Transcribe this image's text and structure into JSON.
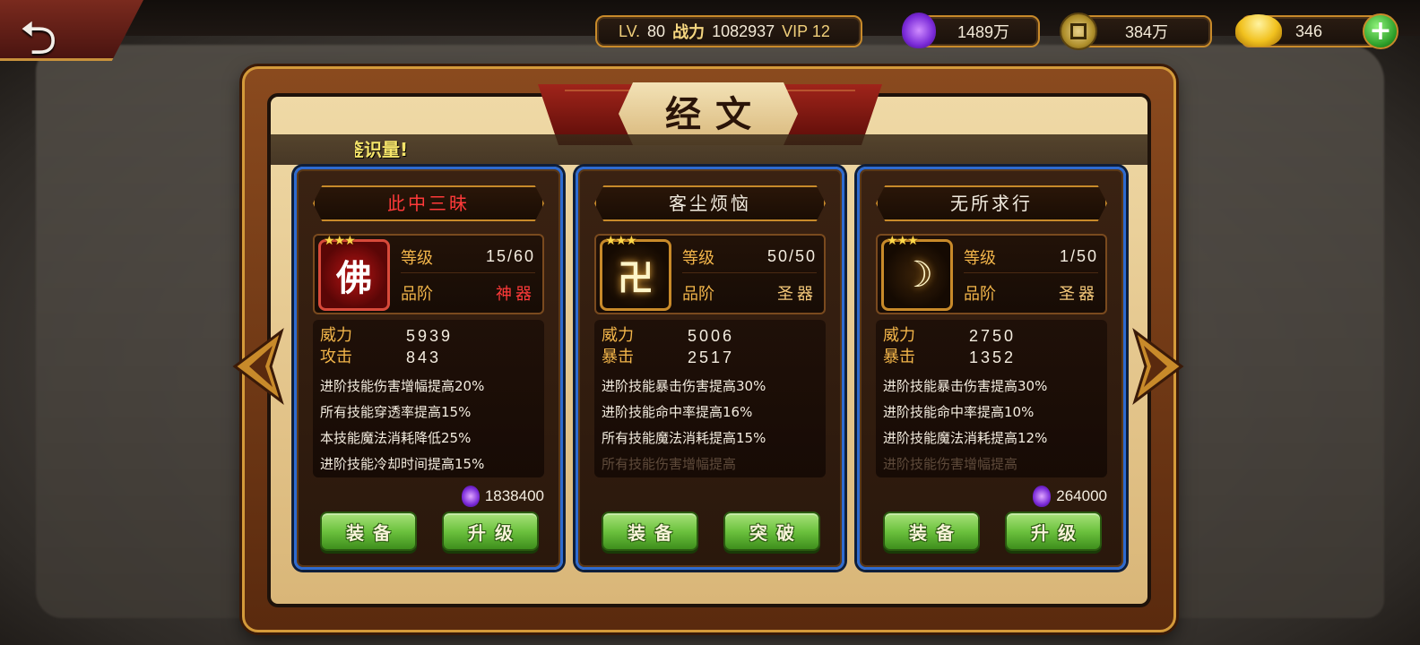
{
  "topbar": {
    "level_label": "LV.",
    "level_value": "80",
    "power_label": "战力",
    "power_value": "1082937",
    "vip_label": "VIP 12",
    "spirit_amount": "1489万",
    "coin_amount": "384万",
    "ingot_amount": "346"
  },
  "title": "经文",
  "marquee": "鉴识量!",
  "cards": [
    {
      "name": "此中三昧",
      "name_color": "red",
      "rune_glyph": "佛",
      "stars": "★★★",
      "level_label": "等级",
      "level_value": "15/60",
      "grade_label": "品阶",
      "grade_value": "神器",
      "stat1_label": "威力",
      "stat1_value": "5939",
      "stat2_label": "攻击",
      "stat2_value": "843",
      "effects": [
        "进阶技能伤害增幅提高20%",
        "所有技能穿透率提高15%",
        "本技能魔法消耗降低25%",
        "进阶技能冷却时间提高15%"
      ],
      "cost": "1838400",
      "btn_left": "装备",
      "btn_right": "升级"
    },
    {
      "name": "客尘烦恼",
      "name_color": "white",
      "rune_glyph": "卍",
      "stars": "★★★",
      "level_label": "等级",
      "level_value": "50/50",
      "grade_label": "品阶",
      "grade_value": "圣器",
      "stat1_label": "威力",
      "stat1_value": "5006",
      "stat2_label": "暴击",
      "stat2_value": "2517",
      "effects": [
        "进阶技能暴击伤害提高30%",
        "进阶技能命中率提高16%",
        "所有技能魔法消耗提高15%",
        "所有技能伤害增幅提高"
      ],
      "cost": "",
      "btn_left": "装备",
      "btn_right": "突破"
    },
    {
      "name": "无所求行",
      "name_color": "white",
      "rune_glyph": "☽",
      "stars": "★★★",
      "level_label": "等级",
      "level_value": "1/50",
      "grade_label": "品阶",
      "grade_value": "圣器",
      "stat1_label": "威力",
      "stat1_value": "2750",
      "stat2_label": "暴击",
      "stat2_value": "1352",
      "effects": [
        "进阶技能暴击伤害提高30%",
        "进阶技能命中率提高10%",
        "进阶技能魔法消耗提高12%",
        "进阶技能伤害增幅提高"
      ],
      "cost": "264000",
      "btn_left": "装备",
      "btn_right": "升级"
    }
  ],
  "icons": {
    "back": "back-arrow-icon",
    "spirit": "purple-flame-icon",
    "coin": "copper-coin-icon",
    "ingot": "gold-ingot-icon",
    "add": "plus-icon",
    "prev": "chevron-left-icon",
    "next": "chevron-right-icon"
  },
  "colors": {
    "card_border": "#2e6bd0",
    "button_green": "#6cc23e",
    "title_red": "#ff3a3a",
    "label_gold": "#f2b54a"
  }
}
